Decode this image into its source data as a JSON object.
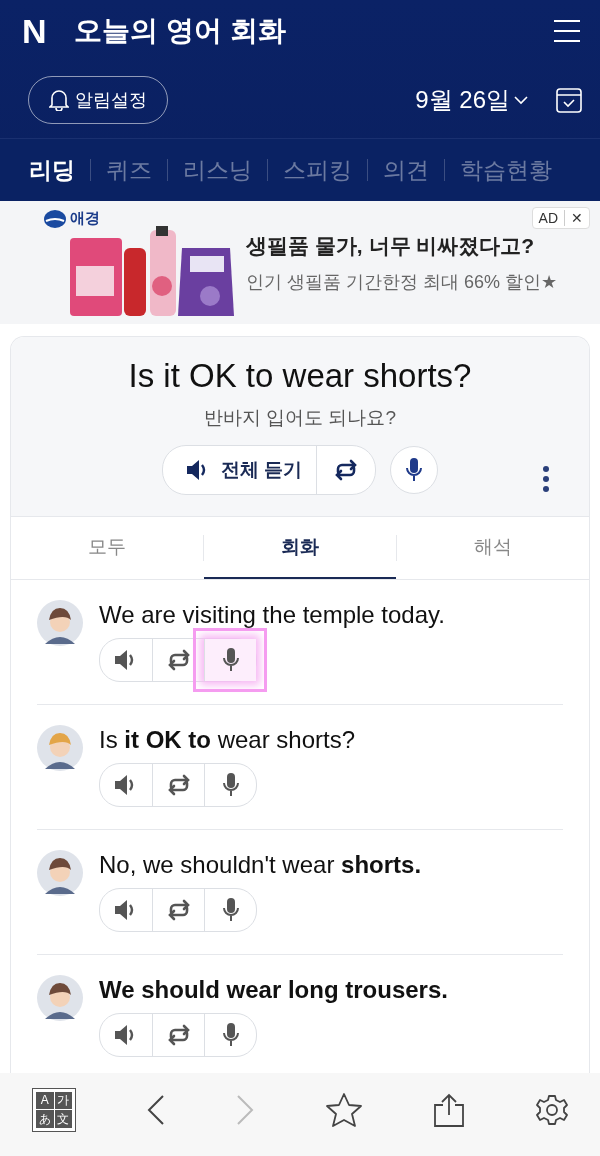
{
  "header": {
    "logo": "N",
    "title": "오늘의 영어 회화"
  },
  "date_bar": {
    "alarm_button": "알림설정",
    "date": "9월 26일"
  },
  "nav_tabs": [
    {
      "label": "리딩",
      "selected": true
    },
    {
      "label": "퀴즈",
      "selected": false
    },
    {
      "label": "리스닝",
      "selected": false
    },
    {
      "label": "스피킹",
      "selected": false
    },
    {
      "label": "의견",
      "selected": false
    },
    {
      "label": "학습현황",
      "selected": false
    }
  ],
  "ad": {
    "brand": "애경",
    "headline": "생필품 물가, 너무 비싸졌다고?",
    "subline": "인기 생필품 기간한정 최대 66% 할인★",
    "badge": "AD",
    "close": "✕"
  },
  "lesson": {
    "sentence": "Is it OK to wear shorts?",
    "translation": "반바지 입어도 되나요?",
    "listen_all": "전체 듣기"
  },
  "view_tabs": [
    {
      "label": "모두",
      "selected": false
    },
    {
      "label": "회화",
      "selected": true
    },
    {
      "label": "해석",
      "selected": false
    }
  ],
  "dialog": [
    {
      "text": "We are visiting the temple today.",
      "bold": false,
      "color": "#6e4a3a",
      "mic_highlighted": true
    },
    {
      "text": "Is **it OK to** wear shorts?",
      "bold": false,
      "color": "#e3a548",
      "mic_highlighted": false
    },
    {
      "text": "No, we shouldn't wear **shorts.**",
      "bold": false,
      "color": "#6e4a3a",
      "mic_highlighted": false
    },
    {
      "text": "We should wear long trousers.",
      "bold": true,
      "color": "#6e4a3a",
      "mic_highlighted": false
    }
  ],
  "bottom_bar": {
    "translate_glyphs": [
      "A",
      "가",
      "あ",
      "文"
    ],
    "forward_disabled": true
  }
}
